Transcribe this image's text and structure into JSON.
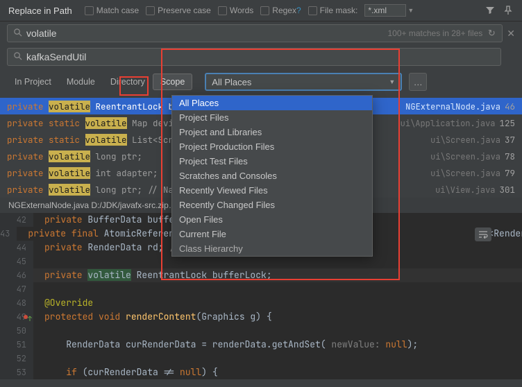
{
  "title": "Replace in Path",
  "checks": {
    "match_case": "Match case",
    "preserve_case": "Preserve case",
    "words": "Words",
    "regex": "Regex",
    "filemask": "File mask:"
  },
  "filemask_value": "*.xml",
  "search": {
    "find_value": "volatile",
    "replace_value": "kafkaSendUtil",
    "stats": "100+ matches in 28+ files"
  },
  "tabs": [
    "In Project",
    "Module",
    "Directory",
    "Scope"
  ],
  "active_tab": "Scope",
  "scope_selected": "All Places",
  "scope_options": [
    "All Places",
    "Project Files",
    "Project and Libraries",
    "Project Production Files",
    "Project Test Files",
    "Scratches and Consoles",
    "Recently Viewed Files",
    "Recently Changed Files",
    "Open Files",
    "Current File",
    "Class Hierarchy"
  ],
  "results": [
    {
      "pre": "private ",
      "match": "volatile",
      "post": " ReentrantLock bufferLock;",
      "path": "NGExternalNode.java",
      "line": "46",
      "selected": true
    },
    {
      "pre": "private static ",
      "match": "volatile",
      "post": " Map deviceDetails = n",
      "path": "ui\\Application.java",
      "line": "125"
    },
    {
      "pre": "private static ",
      "match": "volatile",
      "post": " List<Screen> screens =",
      "path": "ui\\Screen.java",
      "line": "37"
    },
    {
      "pre": "private ",
      "match": "volatile",
      "post": " long ptr;",
      "path": "ui\\Screen.java",
      "line": "78"
    },
    {
      "pre": "private ",
      "match": "volatile",
      "post": " int adapter;",
      "path": "ui\\Screen.java",
      "line": "79"
    },
    {
      "pre": "private ",
      "match": "volatile",
      "post": " long ptr; // Native handle (N",
      "path": "ui\\View.java",
      "line": "301"
    }
  ],
  "filepath": "NGExternalNode.java   D:/JDK/javafx-src.zip…",
  "code_lines": [
    {
      "n": "42",
      "html": "<span class='tok-kw'>private</span> BufferData bufferDa"
    },
    {
      "n": "43",
      "html": "<span class='tok-kw'>private final</span> AtomicReferen<span style='visibility:hidden'>xxxxxxxxxxxxxxxxxxxxxxxxxxxxxxxxxxxxxxxxxxxxxxxxxxxxxxxx</span>ce&lt;RenderData&gt;( <span class='tok-label'>initialValue:</span> <span class='tok-null'>null</span>)"
    },
    {
      "n": "44",
      "html": "<span class='tok-kw'>private</span> RenderData rd; <span class='tok-comment'>// last rendered data</span>"
    },
    {
      "n": "45",
      "html": ""
    },
    {
      "n": "46",
      "html": "<span class='tok-kw'>private</span> <span class='tok-vol-editor'>volatile</span> ReentrantLock bufferLock;",
      "hl": true
    },
    {
      "n": "47",
      "html": ""
    },
    {
      "n": "48",
      "html": "<span class='tok-annot'>@Override</span>"
    },
    {
      "n": "49",
      "html": "<span class='tok-kw'>protected void</span> <span class='tok-method'>renderContent</span>(Graphics g) {",
      "impl": true,
      "err": true
    },
    {
      "n": "50",
      "html": ""
    },
    {
      "n": "51",
      "html": "    RenderData curRenderData = renderData.getAndSet( <span class='tok-label'>newValue:</span> <span class='tok-null'>null</span>);"
    },
    {
      "n": "52",
      "html": ""
    },
    {
      "n": "53",
      "html": "    <span class='tok-kw'>if</span> (curRenderData != <span class='tok-null'>null</span>) {"
    }
  ]
}
